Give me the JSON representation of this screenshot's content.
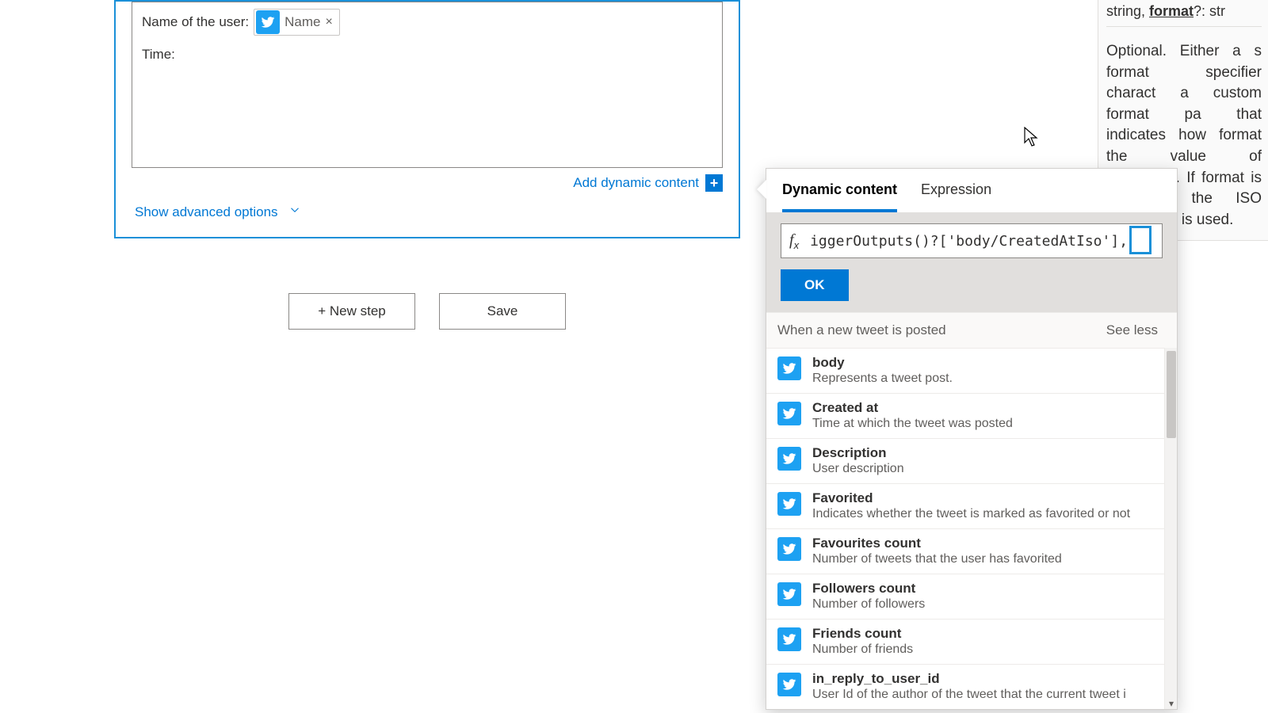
{
  "card": {
    "line1_label": "Name of the user:",
    "token_label": "Name",
    "token_close": "×",
    "line2_label": "Time:",
    "add_dynamic": "Add dynamic content",
    "show_advanced": "Show advanced options"
  },
  "buttons": {
    "new_step": "+ New step",
    "save": "Save"
  },
  "panel": {
    "tab_dynamic": "Dynamic content",
    "tab_expression": "Expression",
    "expression_text": "iggerOutputs()?['body/CreatedAtIso'],",
    "ok": "OK",
    "section_title": "When a new tweet is posted",
    "see_less": "See less",
    "items": [
      {
        "title": "body",
        "desc": "Represents a tweet post."
      },
      {
        "title": "Created at",
        "desc": "Time at which the tweet was posted"
      },
      {
        "title": "Description",
        "desc": "User description"
      },
      {
        "title": "Favorited",
        "desc": "Indicates whether the tweet is marked as favorited or not"
      },
      {
        "title": "Favourites count",
        "desc": "Number of tweets that the user has favorited"
      },
      {
        "title": "Followers count",
        "desc": "Number of followers"
      },
      {
        "title": "Friends count",
        "desc": "Number of friends"
      },
      {
        "title": "in_reply_to_user_id",
        "desc": "User Id of the author of the tweet that the current tweet i"
      }
    ]
  },
  "help": {
    "sig_prefix": "string, ",
    "sig_param": "format",
    "sig_suffix": "?: str",
    "body": "Optional. Either a s format specifier charact a custom format pa that indicates how format the value of timestamp. If format is provided, the ISO format ('o') is used."
  }
}
